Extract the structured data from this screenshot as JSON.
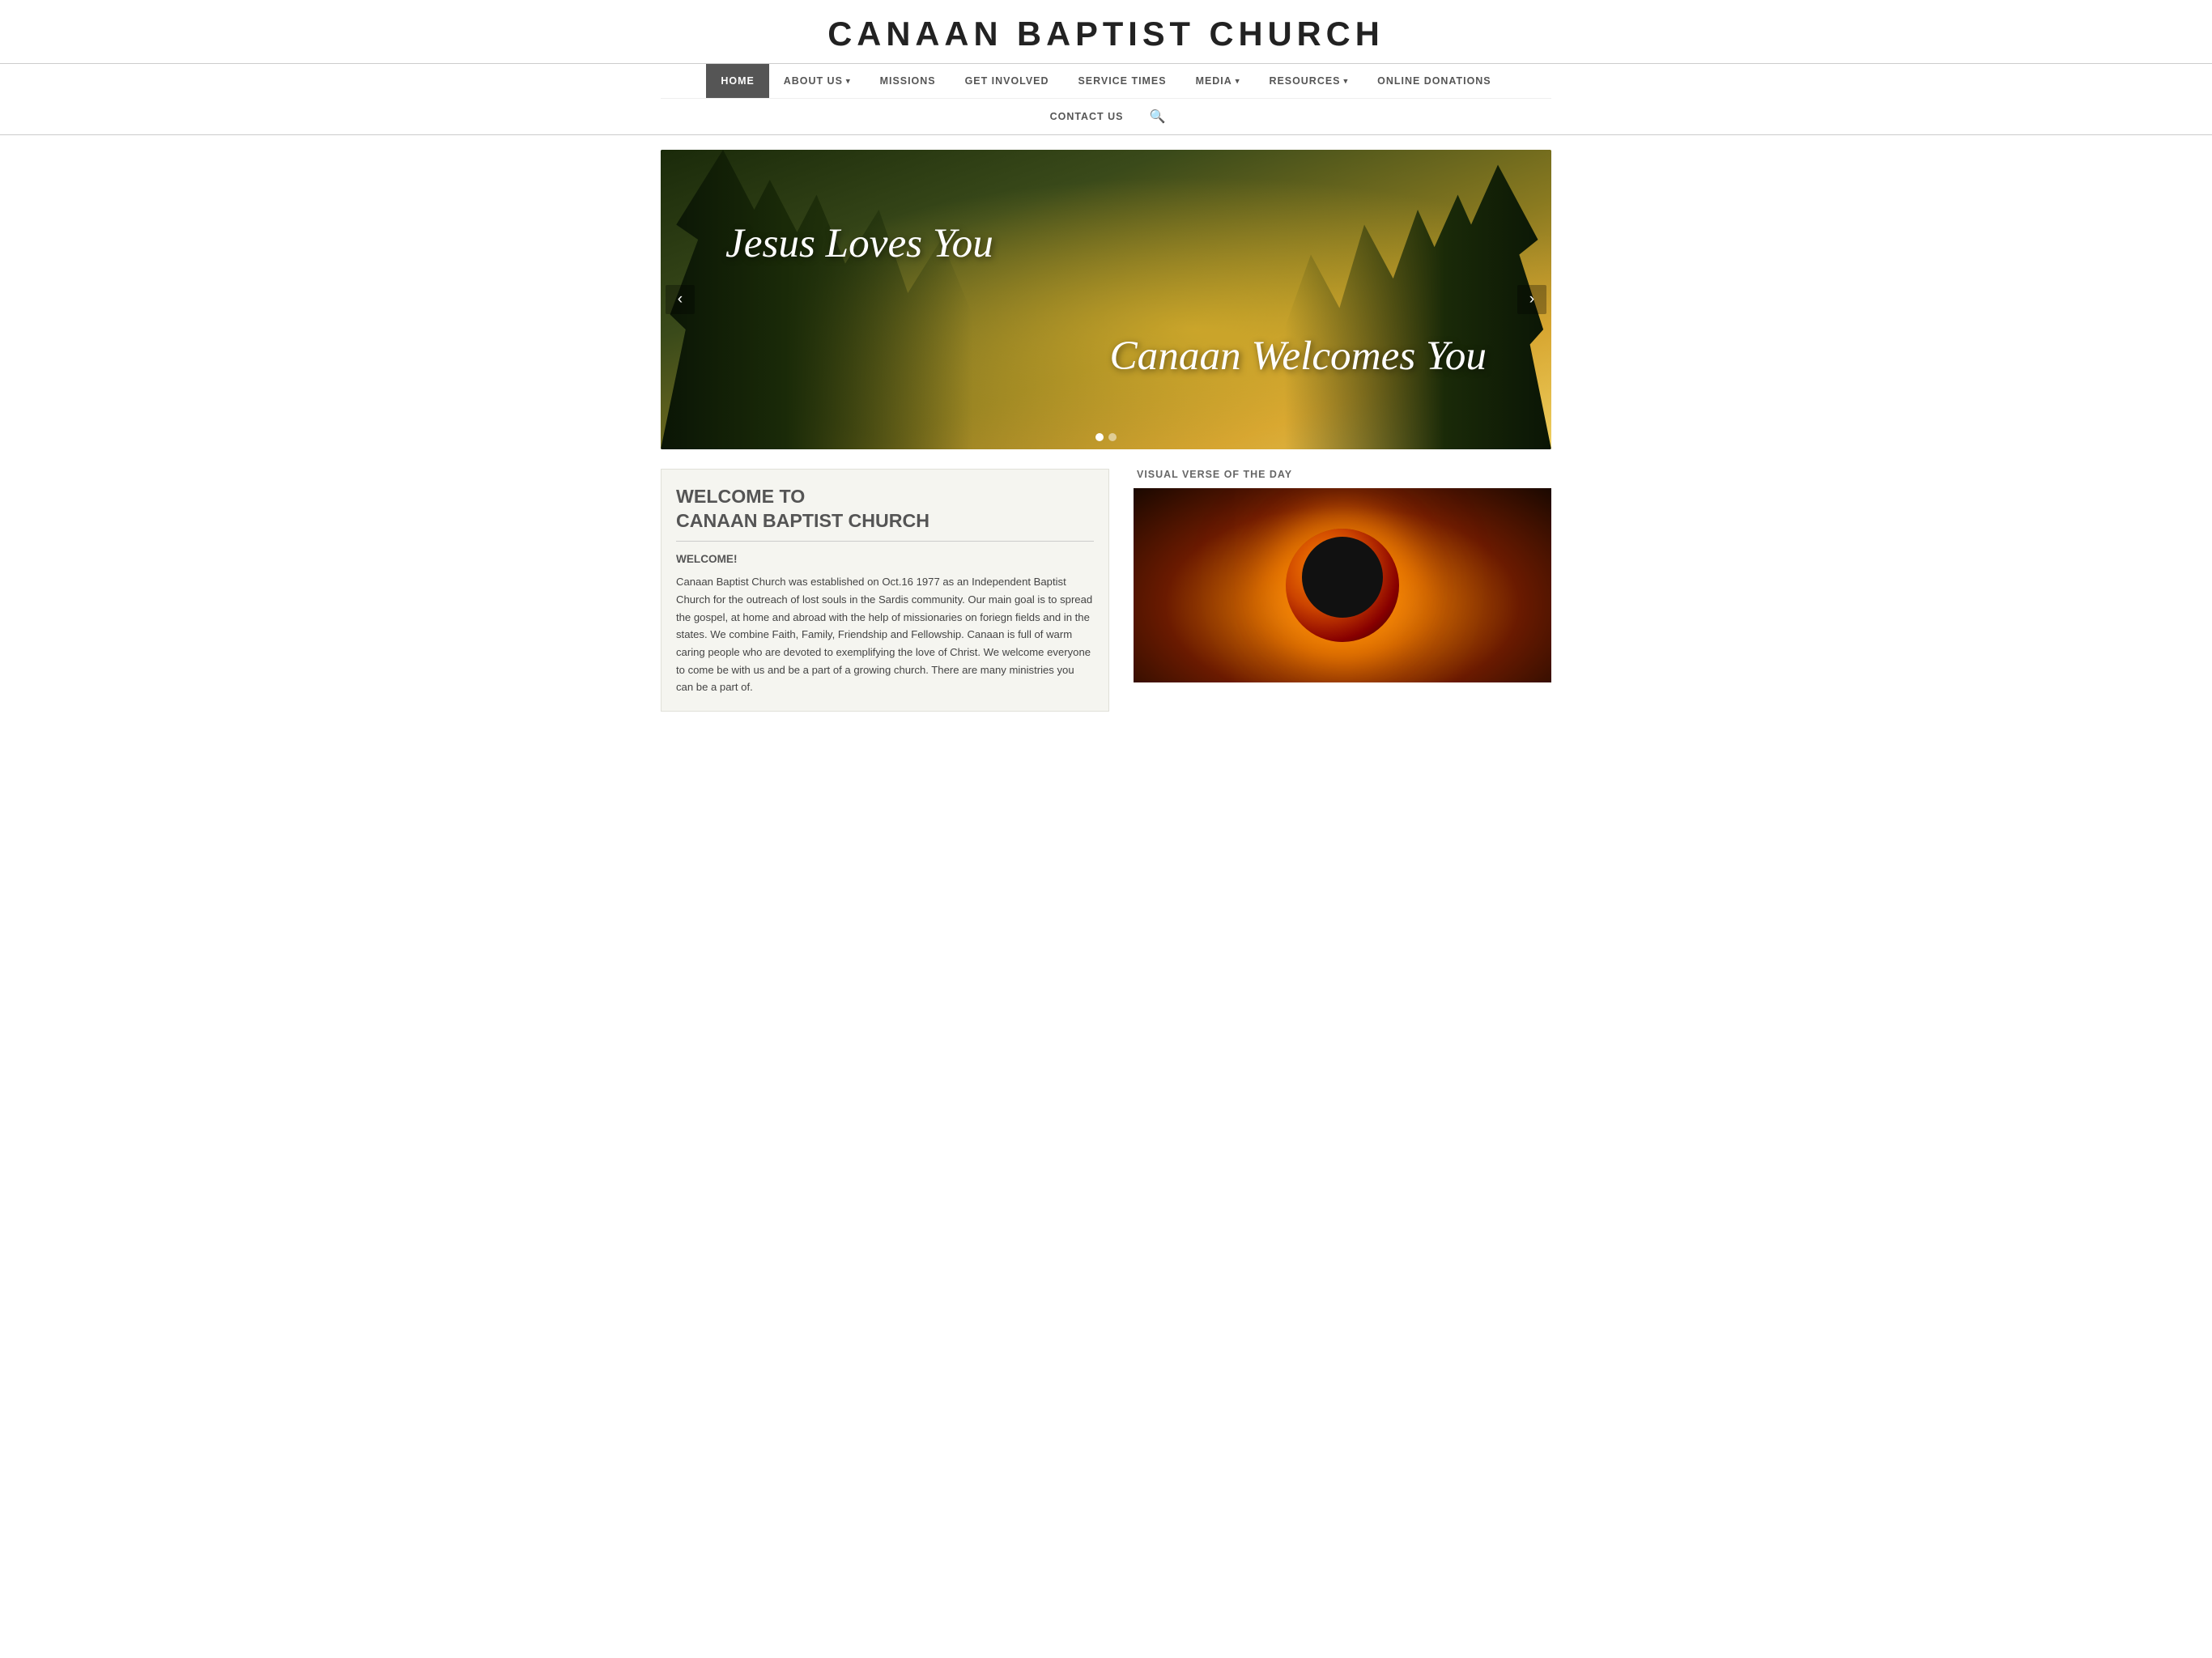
{
  "header": {
    "site_title": "CANAAN BAPTIST CHURCH"
  },
  "nav": {
    "row1_items": [
      {
        "label": "HOME",
        "active": true,
        "has_caret": false,
        "id": "home"
      },
      {
        "label": "ABOUT US",
        "active": false,
        "has_caret": true,
        "id": "about-us"
      },
      {
        "label": "MISSIONS",
        "active": false,
        "has_caret": false,
        "id": "missions"
      },
      {
        "label": "GET INVOLVED",
        "active": false,
        "has_caret": false,
        "id": "get-involved"
      },
      {
        "label": "SERVICE TIMES",
        "active": false,
        "has_caret": false,
        "id": "service-times"
      },
      {
        "label": "MEDIA",
        "active": false,
        "has_caret": true,
        "id": "media"
      },
      {
        "label": "RESOURCES",
        "active": false,
        "has_caret": true,
        "id": "resources"
      },
      {
        "label": "ONLINE DONATIONS",
        "active": false,
        "has_caret": false,
        "id": "online-donations"
      }
    ],
    "row2_items": [
      {
        "label": "CONTACT US",
        "active": false,
        "has_caret": false,
        "id": "contact-us"
      }
    ]
  },
  "hero": {
    "line1": "Jesus Loves You",
    "line2": "Canaan Welcomes You",
    "prev_label": "‹",
    "next_label": "›",
    "dots": [
      {
        "active": true
      },
      {
        "active": false
      }
    ]
  },
  "welcome": {
    "title_line1": "WELCOME TO",
    "title_line2": "CANAAN BAPTIST CHURCH",
    "subtitle": "WELCOME!",
    "body": "Canaan Baptist Church was established on Oct.16 1977 as an Independent Baptist Church for the outreach of lost souls in the Sardis community. Our main goal is to spread the gospel, at home and abroad with the help of missionaries on foriegn fields and in the states. We combine Faith, Family, Friendship and Fellowship. Canaan is full of warm caring people who are devoted to exemplifying the love of Christ. We welcome everyone to come be with us and be a part of a growing church. There are many ministries you can be a part of."
  },
  "visual_verse": {
    "title": "VISUAL VERSE OF THE DAY"
  }
}
